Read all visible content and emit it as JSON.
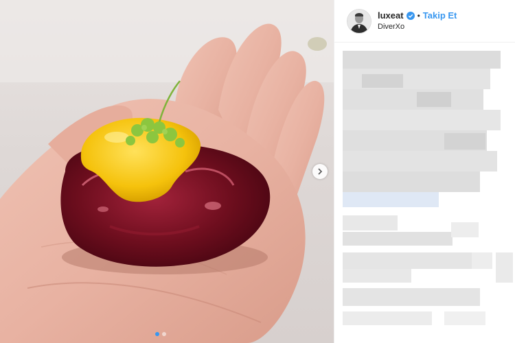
{
  "post": {
    "username": "luxeat",
    "follow_label": "Takip Et",
    "separator": "•",
    "location": "DiverXo",
    "verified": true
  },
  "carousel": {
    "slide_count": 2,
    "active_slide": 1
  },
  "icons": {
    "verified": "verified-badge-icon",
    "next": "chevron-right-icon"
  },
  "colors": {
    "accent": "#3897f0",
    "text": "#262626",
    "border": "#efefef"
  }
}
